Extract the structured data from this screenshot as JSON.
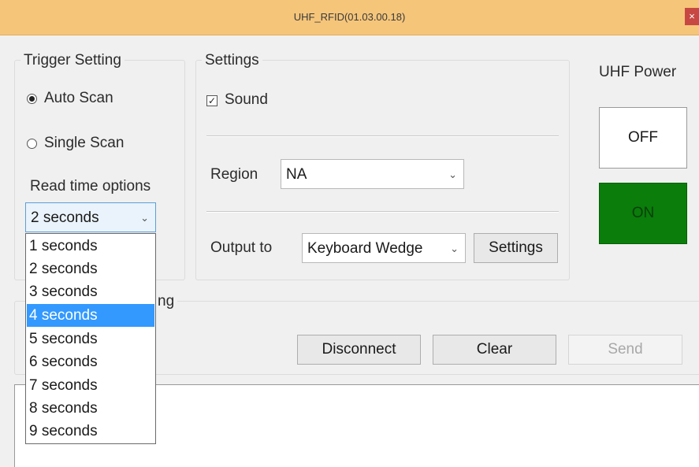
{
  "window": {
    "title": "UHF_RFID(01.03.00.18)",
    "close_glyph": "×"
  },
  "trigger": {
    "legend": "Trigger Setting",
    "auto_scan": "Auto Scan",
    "single_scan": "Single Scan",
    "selected": "auto_scan",
    "read_time_label": "Read time options",
    "read_time_value": "2 seconds",
    "read_time_options": [
      "1 seconds",
      "2 seconds",
      "3 seconds",
      "4 seconds",
      "5 seconds",
      "6 seconds",
      "7 seconds",
      "8 seconds",
      "9 seconds"
    ],
    "highlighted_option": "4 seconds"
  },
  "settings": {
    "legend": "Settings",
    "sound_label": "Sound",
    "sound_checked": true,
    "region_label": "Region",
    "region_value": "NA",
    "output_label": "Output to",
    "output_value": "Keyboard Wedge",
    "settings_button": "Settings"
  },
  "power": {
    "label": "UHF Power",
    "off": "OFF",
    "on": "ON",
    "on_color": "#0a7d0a"
  },
  "lower_group": {
    "legend_fragment": "ng"
  },
  "actions": {
    "disconnect": "Disconnect",
    "clear": "Clear",
    "send": "Send"
  },
  "icons": {
    "dropdown_arrow": "chevron-down-icon",
    "close": "close-icon",
    "check": "check-icon"
  }
}
